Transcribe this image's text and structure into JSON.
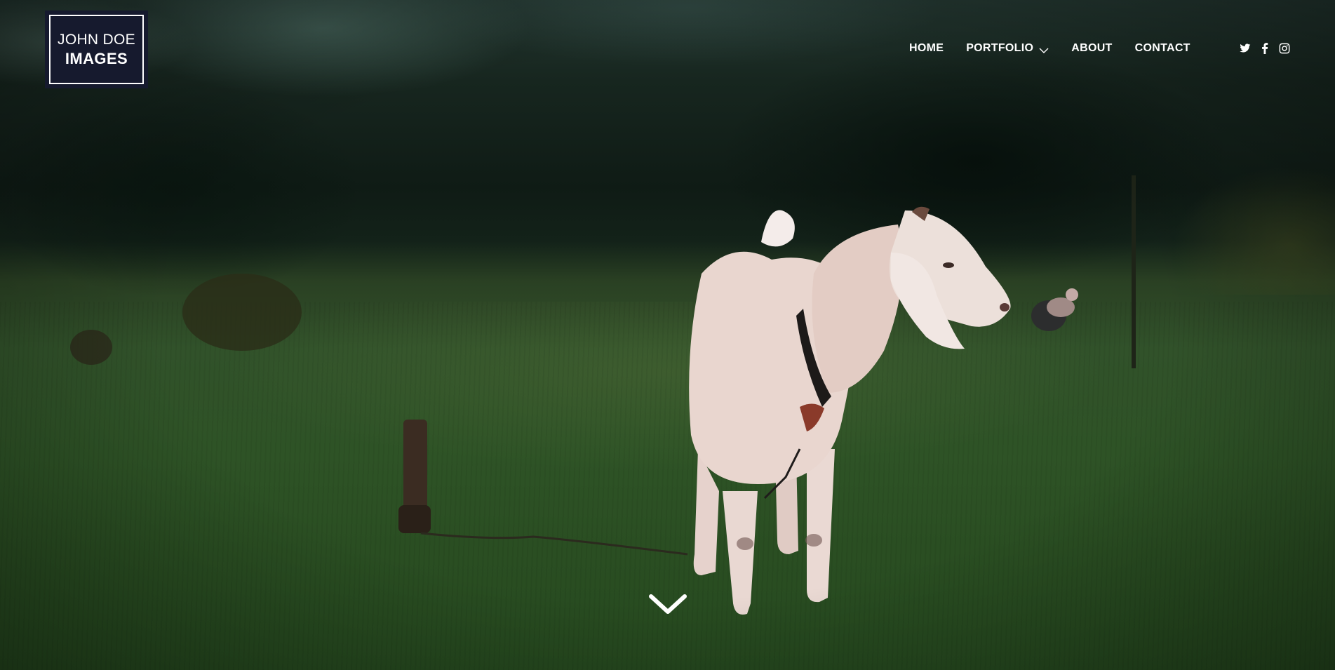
{
  "logo": {
    "line1": "JOHN DOE",
    "line2": "IMAGES"
  },
  "nav": {
    "items": [
      {
        "label": "HOME"
      },
      {
        "label": "PORTFOLIO",
        "has_dropdown": true
      },
      {
        "label": "ABOUT"
      },
      {
        "label": "CONTACT"
      }
    ]
  },
  "social": [
    {
      "icon": "twitter-icon"
    },
    {
      "icon": "facebook-icon"
    },
    {
      "icon": "instagram-icon"
    }
  ],
  "hero": {
    "scroll_icon": "chevron-down-icon",
    "image_subject": "goat-in-field-photo"
  },
  "colors": {
    "logo_bg": "#161a2e",
    "text": "#ffffff"
  }
}
